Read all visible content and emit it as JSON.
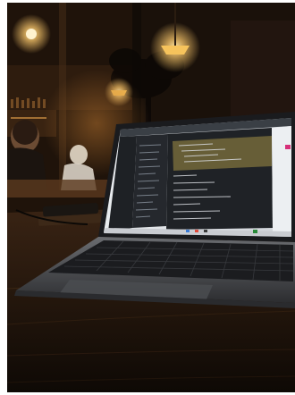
{
  "scene": {
    "kind": "photograph",
    "subject": "laptop-on-cafe-table",
    "setting": "dim-cafe-interior",
    "colors": {
      "background": "#120c07",
      "warm_light": "#f7c56a",
      "wood": "#2a1a0f",
      "laptop_body": "#55575c",
      "keyboard": "#1b1c1f",
      "screen_editor": "#1f2226",
      "screen_sidebar": "#25282d",
      "screen_header": "#3a3f45",
      "highlight_bar": "#6b6238",
      "accent_pink": "#d6307a"
    }
  }
}
